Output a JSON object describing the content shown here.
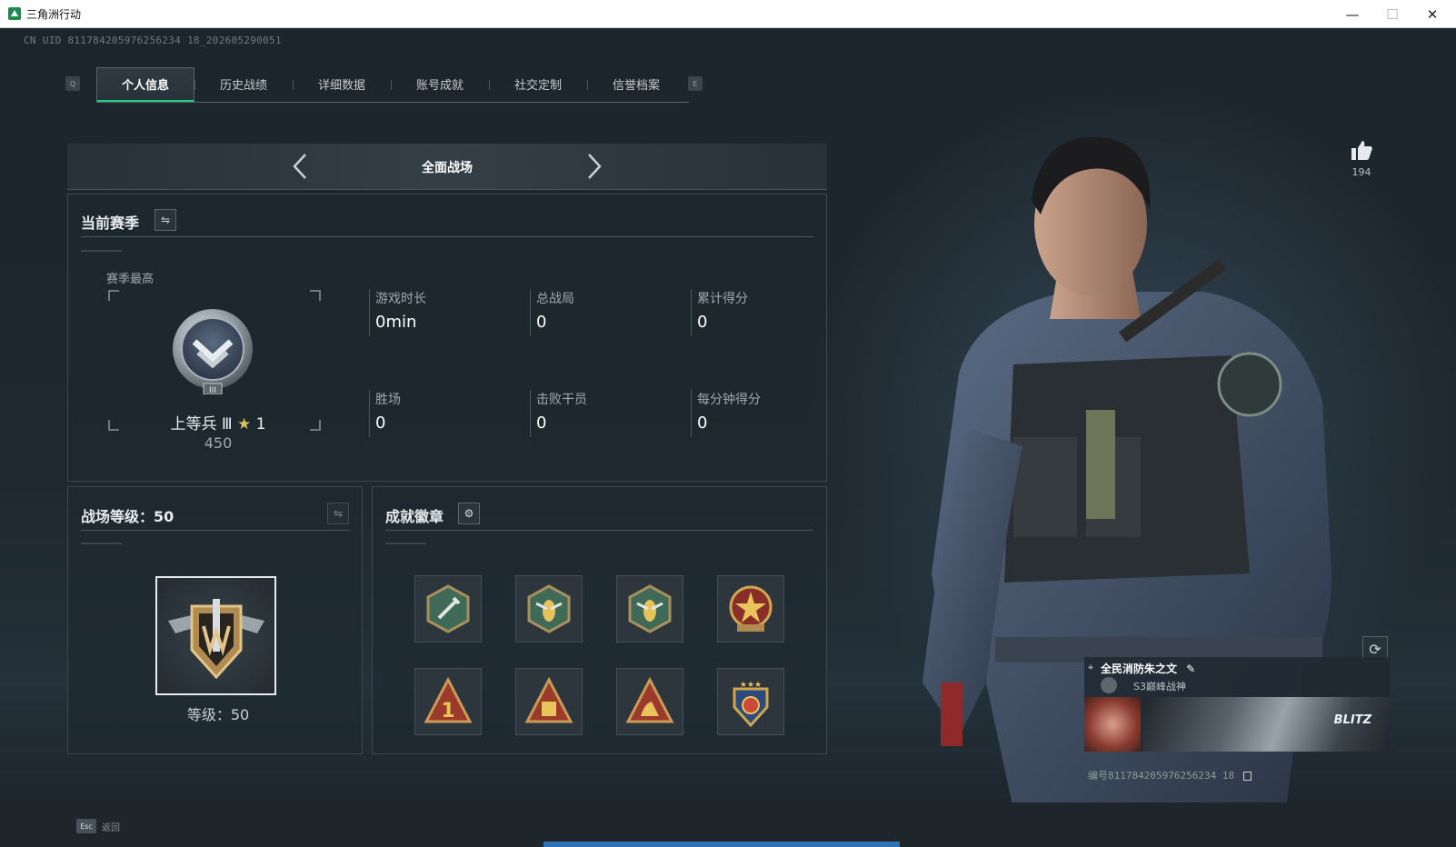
{
  "window": {
    "title": "三角洲行动",
    "minimize": "—",
    "maximize": "☐",
    "close": "✕"
  },
  "uid_line": "CN UID 811784205976256234 18_202605290051",
  "tabs": {
    "left_key": "Q",
    "right_key": "E",
    "items": [
      {
        "label": "个人信息",
        "active": true
      },
      {
        "label": "历史战绩",
        "active": false
      },
      {
        "label": "详细数据",
        "active": false
      },
      {
        "label": "账号成就",
        "active": false
      },
      {
        "label": "社交定制",
        "active": false
      },
      {
        "label": "信誉档案",
        "active": false
      }
    ]
  },
  "mode": {
    "title": "全面战场"
  },
  "season": {
    "title": "当前赛季",
    "best_label": "赛季最高",
    "rank_name": "上等兵 Ⅲ",
    "stars": "1",
    "rank_points": "450",
    "stats": [
      {
        "label": "游戏时长",
        "value": "0min"
      },
      {
        "label": "总战局",
        "value": "0"
      },
      {
        "label": "累计得分",
        "value": "0"
      },
      {
        "label": "胜场",
        "value": "0"
      },
      {
        "label": "击败干员",
        "value": "0"
      },
      {
        "label": "每分钟得分",
        "value": "0"
      }
    ]
  },
  "battlefield_level": {
    "title": "战场等级：50",
    "level_text": "等级：50"
  },
  "achievements": {
    "title": "成就徽章"
  },
  "like": {
    "count": "194"
  },
  "player_card": {
    "name": "全民消防朱之文",
    "subtitle": "S3巅峰战神",
    "banner_text": "BLITZ",
    "id_line": "编号811784205976256234 18"
  },
  "footer": {
    "esc_key": "Esc",
    "back_label": "返回"
  },
  "colors": {
    "accent": "#1fcf86",
    "panel_border": "#3d4950",
    "bottom_bar": "#2f74b8"
  }
}
